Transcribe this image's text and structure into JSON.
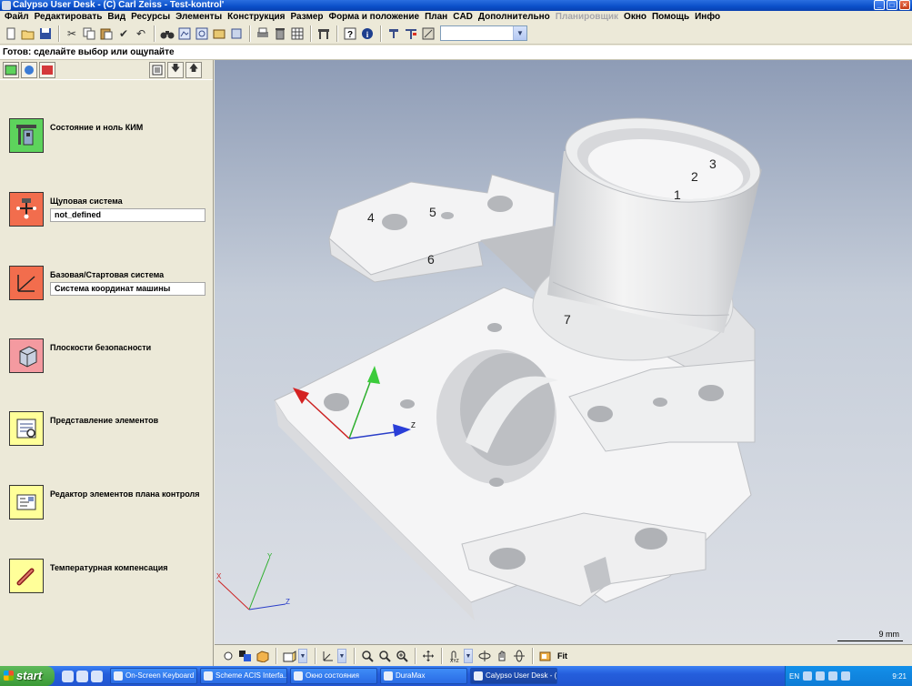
{
  "window": {
    "title": "Calypso User Desk - (C) Carl Zeiss - Test-kontrol'",
    "controls": [
      "_",
      "□",
      "×"
    ]
  },
  "menu": {
    "items": [
      {
        "label": "Файл",
        "enabled": true
      },
      {
        "label": "Редактировать",
        "enabled": true
      },
      {
        "label": "Вид",
        "enabled": true
      },
      {
        "label": "Ресурсы",
        "enabled": true
      },
      {
        "label": "Элементы",
        "enabled": true
      },
      {
        "label": "Конструкция",
        "enabled": true
      },
      {
        "label": "Размер",
        "enabled": true
      },
      {
        "label": "Форма и положение",
        "enabled": true
      },
      {
        "label": "План",
        "enabled": true
      },
      {
        "label": "CAD",
        "enabled": true
      },
      {
        "label": "Дополнительно",
        "enabled": true
      },
      {
        "label": "Планировщик",
        "enabled": false
      },
      {
        "label": "Окно",
        "enabled": true
      },
      {
        "label": "Помощь",
        "enabled": true
      },
      {
        "label": "Инфо",
        "enabled": true
      }
    ]
  },
  "toolbar": {
    "icons": [
      "new-icon",
      "open-icon",
      "save-icon",
      "cut-icon",
      "copy-icon",
      "paste-icon",
      "check-icon",
      "undo-icon",
      "binoculars-icon",
      "view-a-icon",
      "view-b-icon",
      "view-c-icon",
      "view-d-icon",
      "print-icon",
      "delete-icon",
      "grid-icon",
      "cmm-icon",
      "help-icon",
      "info-icon",
      "probe-a-icon",
      "probe-b-icon",
      "probe-c-icon"
    ],
    "combo_value": ""
  },
  "status": {
    "text": "Готов: сделайте выбор или ощупайте"
  },
  "left_panel": {
    "items": [
      {
        "label": "Состояние и ноль КИМ",
        "color": "green",
        "icon": "cmm-state-icon",
        "field": null
      },
      {
        "label": "Щуповая система",
        "color": "red",
        "icon": "probe-system-icon",
        "field": "not_defined"
      },
      {
        "label": "Базовая/Стартовая система",
        "color": "red",
        "icon": "base-system-icon",
        "field": "Система координат машины"
      },
      {
        "label": "Плоскости безопасности",
        "color": "pink",
        "icon": "safety-planes-icon",
        "field": null
      },
      {
        "label": "Представление элементов",
        "color": "yellow",
        "icon": "element-view-icon",
        "field": null
      },
      {
        "label": "Редактор элементов плана контроля",
        "color": "yellow",
        "icon": "plan-editor-icon",
        "field": null
      },
      {
        "label": "Температурная компенсация",
        "color": "yellow",
        "icon": "temperature-icon",
        "field": null
      }
    ]
  },
  "viewport": {
    "feature_labels": [
      "1",
      "2",
      "3",
      "4",
      "5",
      "6",
      "7"
    ],
    "axis_labels": {
      "x": "X",
      "y": "Y",
      "z": "Z"
    },
    "scale": "9 mm"
  },
  "view_toolbar": {
    "fit_label": "Fit"
  },
  "taskbar": {
    "start": "start",
    "tasks": [
      {
        "label": "On-Screen Keyboard",
        "active": false
      },
      {
        "label": "Scheme ACIS Interfa...",
        "active": false
      },
      {
        "label": "Окно состояния",
        "active": false
      },
      {
        "label": "DuraMax",
        "active": false
      },
      {
        "label": "Calypso User Desk - (...",
        "active": true
      }
    ],
    "tray": {
      "language": "EN",
      "clock": "9:21"
    }
  }
}
